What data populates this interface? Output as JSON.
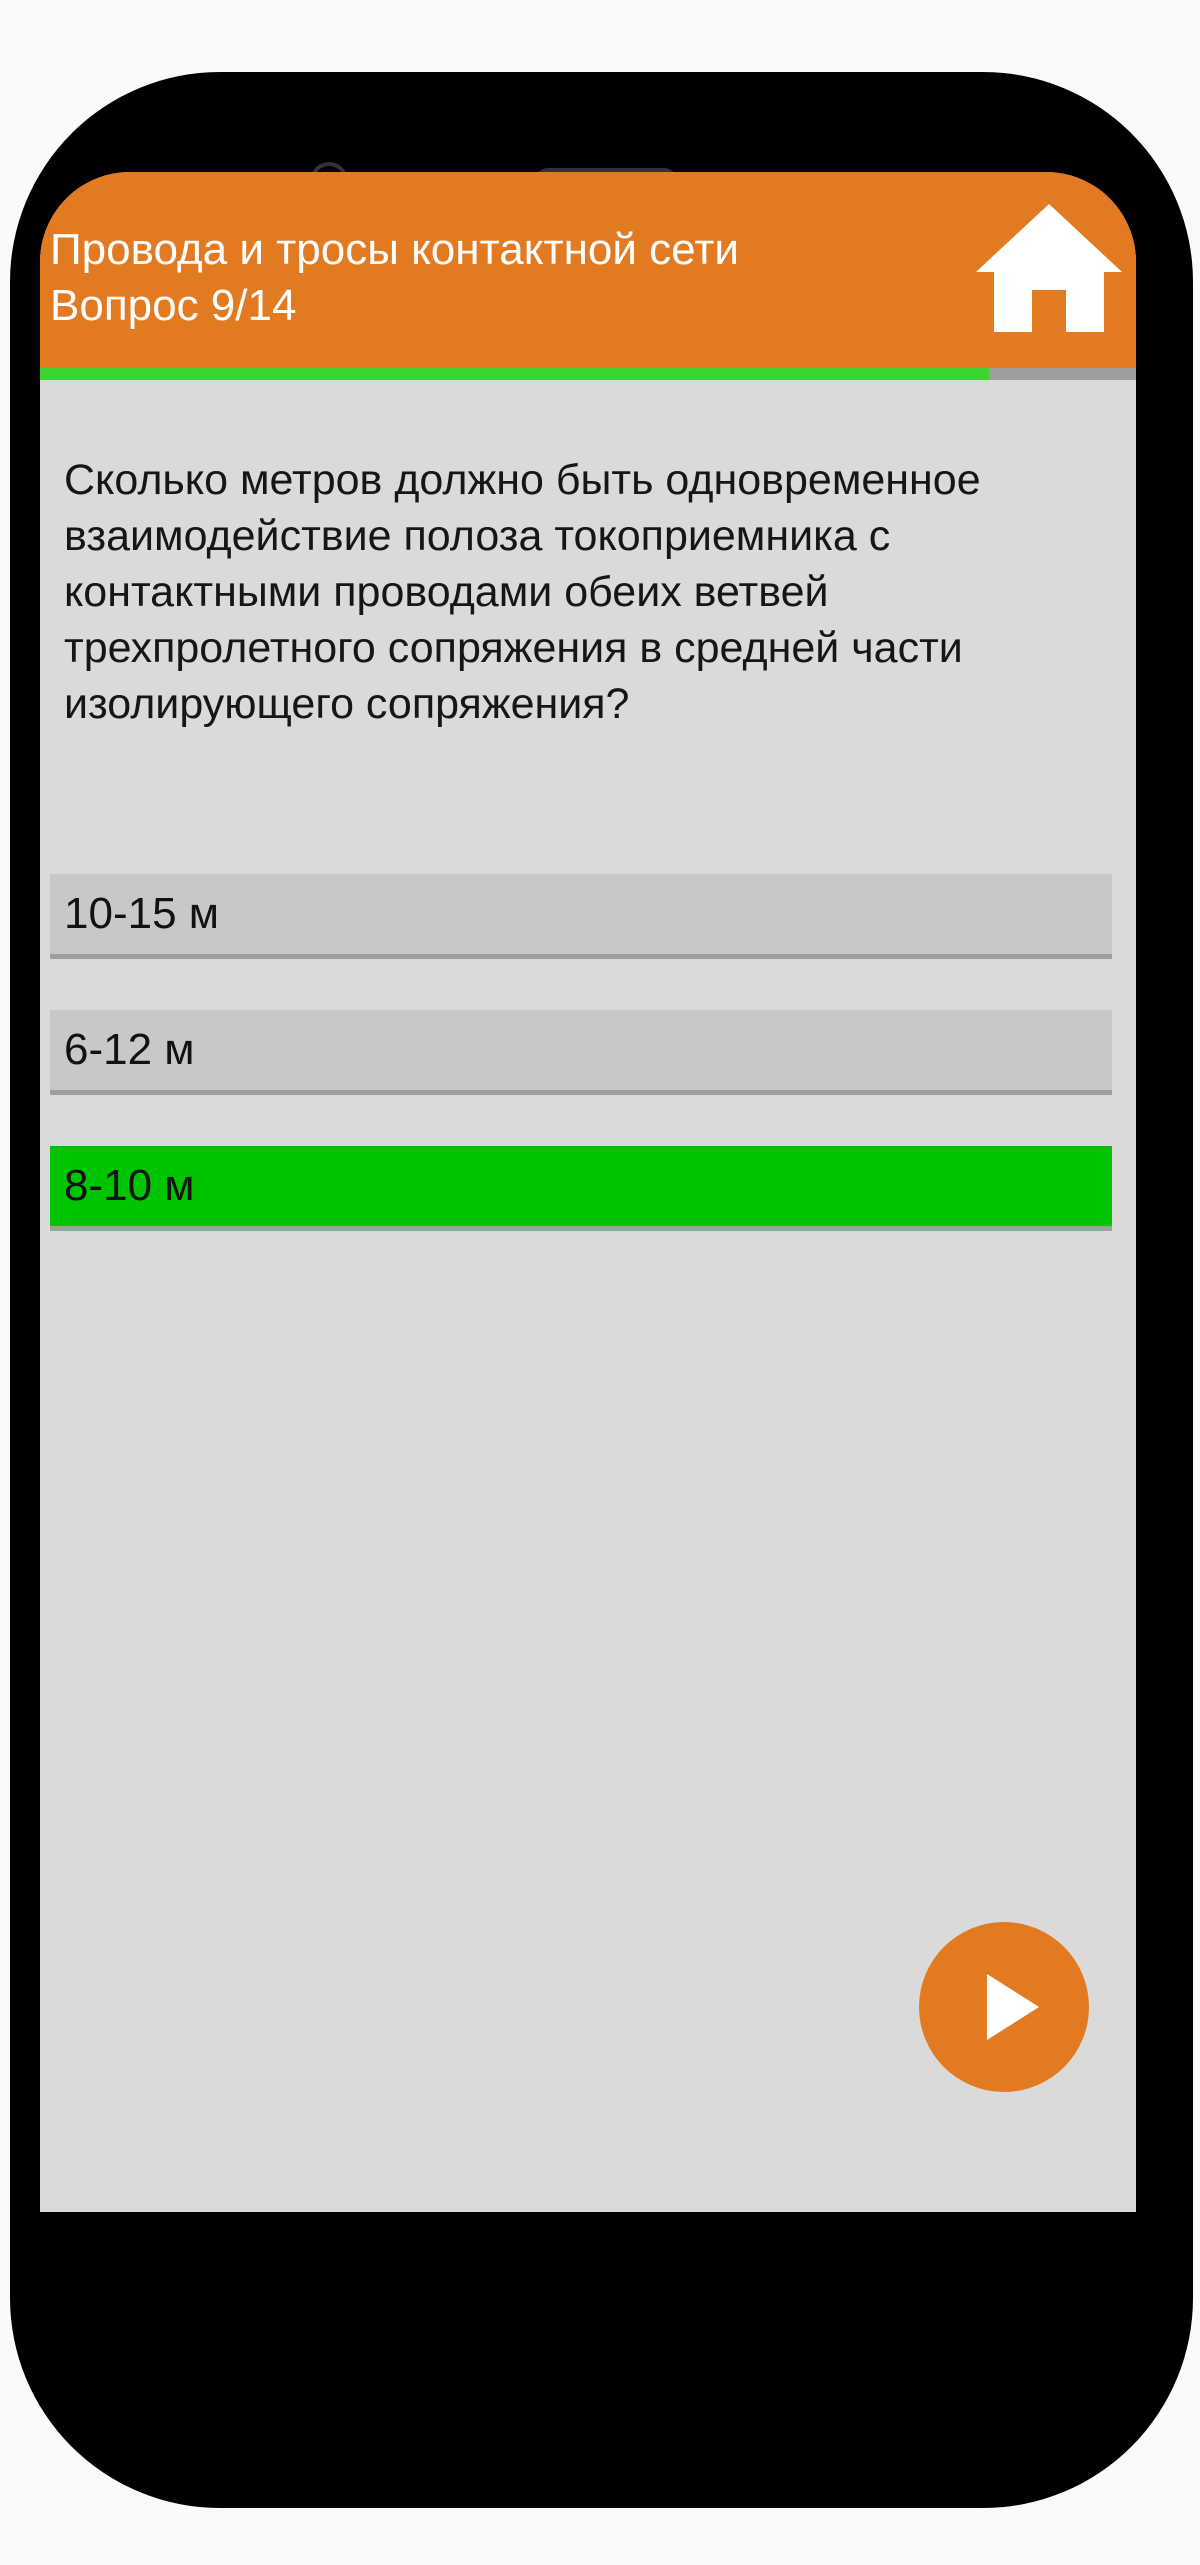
{
  "header": {
    "title": "Провода и тросы контактной сети",
    "subtitle": "Вопрос 9/14"
  },
  "progress": {
    "current": 9,
    "total": 14,
    "fraction": 0.866
  },
  "question": {
    "text": "Сколько метров должно быть одновременное взаимодействие полоза токоприемника с контактными проводами обеих ветвей трехпролетного сопряжения в средней части изолирующего сопряжения?"
  },
  "answers": [
    {
      "label": "10-15 м",
      "state": "default"
    },
    {
      "label": "6-12 м",
      "state": "default"
    },
    {
      "label": "8-10 м",
      "state": "correct"
    }
  ],
  "icons": {
    "home": "home-icon",
    "next": "play-icon"
  },
  "colors": {
    "accent": "#e27a22",
    "progress": "#3cd32e",
    "correct": "#00c400",
    "answer_bg": "#c8c8c8",
    "screen_bg": "#dadada"
  }
}
